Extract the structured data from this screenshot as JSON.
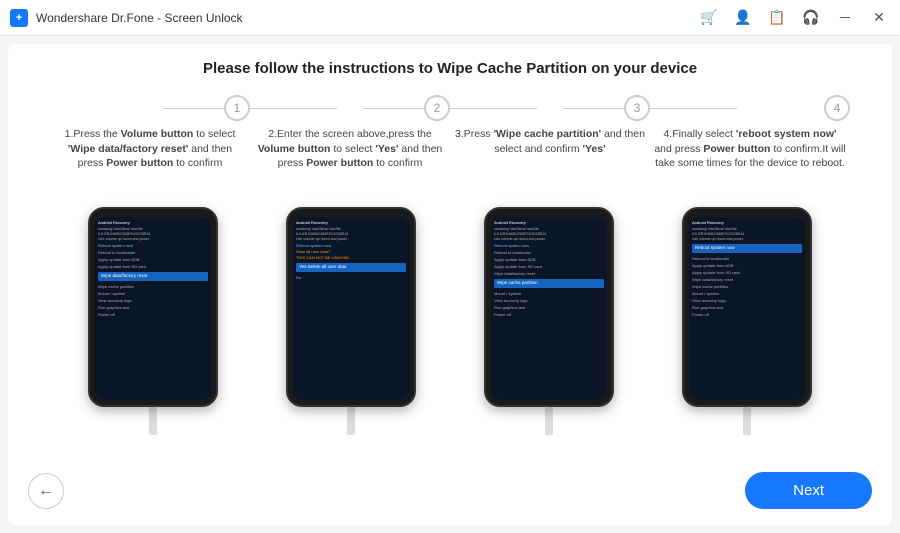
{
  "titleBar": {
    "title": "Wondershare Dr.Fone - Screen Unlock",
    "logoText": "+"
  },
  "page": {
    "title": "Please follow the instructions to Wipe Cache Partition on your device"
  },
  "steps": [
    {
      "number": "1",
      "description": "1.Press the <b>Volume button</b> to select <b>'Wipe data/factory reset'</b> and then press <b>Power button</b> to confirm",
      "highlight": "Wipe data/factory reset",
      "highlightColor": "blue"
    },
    {
      "number": "2",
      "description": "2.Enter the screen above,press the <b>Volume button</b> to select <b>'Yes'</b> and then press <b>Power button</b> to confirm",
      "highlight": "Yes  Delete all user data",
      "highlightColor": "blue"
    },
    {
      "number": "3",
      "description": "3.Press <b>'Wipe cache partition'</b> and then select and confirm <b>'Yes'</b>",
      "highlight": "Wipe cache partition",
      "highlightColor": "blue"
    },
    {
      "number": "4",
      "description": "4.Finally select <b>'reboot system now'</b> and press <b>Power button</b> to confirm.It will take some times for the device to reboot.",
      "highlight": "Reboot system now",
      "highlightColor": "blue"
    }
  ],
  "buttons": {
    "back": "←",
    "next": "Next"
  }
}
